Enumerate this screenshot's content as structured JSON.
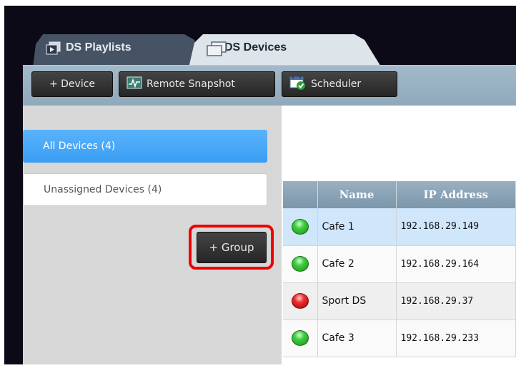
{
  "tabs": [
    {
      "label": "DS Playlists",
      "icon": "playlist-icon"
    },
    {
      "label": "DS Devices",
      "icon": "devices-icon",
      "active": true
    }
  ],
  "toolbar": {
    "add_device": "+ Device",
    "remote_snapshot": "Remote Snapshot",
    "scheduler": "Scheduler"
  },
  "sidebar": {
    "groups": [
      {
        "label": "All Devices (4)",
        "selected": true
      },
      {
        "label": "Unassigned Devices (4)",
        "selected": false
      }
    ],
    "add_group": "+ Group"
  },
  "table": {
    "columns": [
      "",
      "Name",
      "IP Address"
    ],
    "rows": [
      {
        "status": "online",
        "name": "Cafe 1",
        "ip": "192.168.29.149",
        "selected": true
      },
      {
        "status": "online",
        "name": "Cafe 2",
        "ip": "192.168.29.164",
        "selected": false
      },
      {
        "status": "offline",
        "name": "Sport DS",
        "ip": "192.168.29.37",
        "selected": false
      },
      {
        "status": "online",
        "name": "Cafe 3",
        "ip": "192.168.29.233",
        "selected": false
      }
    ]
  },
  "colors": {
    "accent_blue": "#3a9df3",
    "status_online": "#2fb82f",
    "status_offline": "#e02020",
    "highlight": "#ee0000"
  }
}
